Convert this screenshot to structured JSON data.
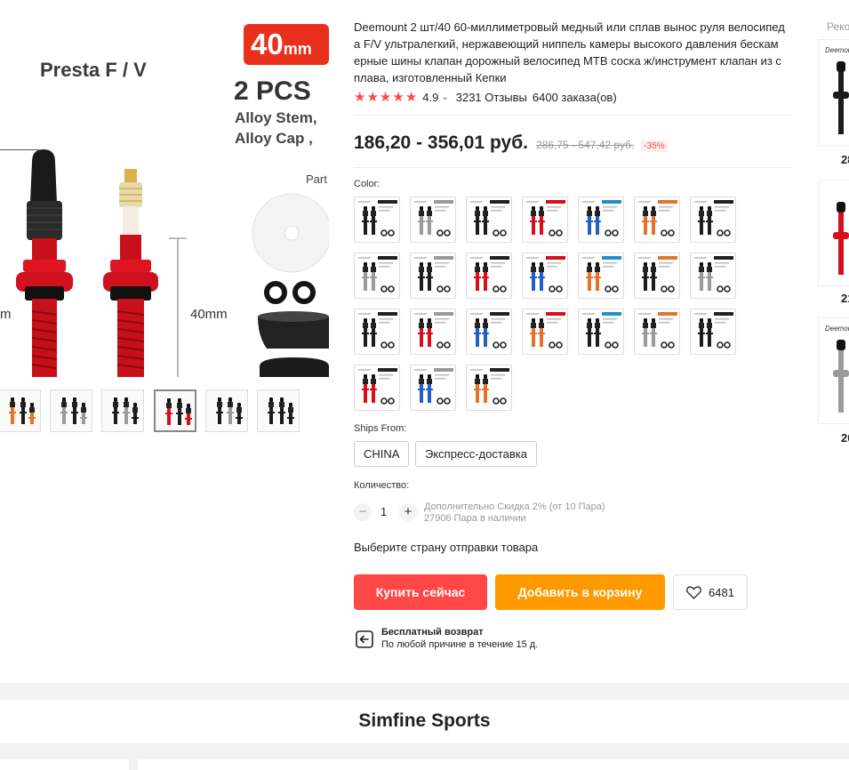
{
  "gallery": {
    "image_label_presta": "Presta F / V",
    "image_badge": "40",
    "image_badge_unit": "mm",
    "image_pcs": "2 PCS",
    "image_alloy_stem": "Alloy Stem,",
    "image_alloy_cap": "Alloy Cap ,",
    "image_parts": "Part",
    "image_measure": "40mm",
    "image_measure_cut": "m",
    "thumbnail_count": 6,
    "active_thumbnail": 4
  },
  "product": {
    "title": "Deemount 2 шт/40 60-миллиметровый медный или сплав вынос руля велосипед a F/V ультралегкий, нержавеющий ниппель камеры высокого давления бескам ерные шины клапан дорожный велосипед MTB соска ж/инструмент клапан из с плава, изготовленный Кепки",
    "rating": "4.9",
    "stars": 5,
    "reviews": "3231 Отзывы",
    "orders": "6400 заказа(ов)",
    "price_current": "186,20 - 356,01 руб.",
    "price_old": "286,75 - 547,42 руб.",
    "discount": "-35%"
  },
  "options": {
    "color_label": "Color:",
    "swatch_count": 24,
    "ships_from_label": "Ships From:",
    "ships_from": [
      "CHINA",
      "Экспресс-доставка"
    ],
    "quantity_label": "Количество:",
    "quantity_minus": "−",
    "quantity_plus": "+",
    "quantity_value": "1",
    "quantity_discount": "Дополнительно Скидка 2% (от 10 Пара)",
    "quantity_stock": "27906 Пара в наличии",
    "ship_country": "Выберите страну отправки товара"
  },
  "actions": {
    "buy_now": "Купить сейчас",
    "add_to_cart": "Добавить в корзину",
    "wishlist_count": "6481"
  },
  "returns": {
    "title": "Бесплатный возврат",
    "desc": "По любой причине в течение 15 д."
  },
  "recommendations": {
    "title": "Реко",
    "brand_label": "Deemount",
    "prices": [
      "28",
      "21",
      "20"
    ]
  },
  "store": {
    "name": "Simfine Sports"
  },
  "colors": {
    "accent_red": "#ff4747",
    "accent_orange": "#ff9900",
    "valve_red": "#d4101c",
    "valve_blue": "#1f5fc8",
    "valve_orange": "#e4732a",
    "valve_black": "#1c1c1c",
    "valve_silver": "#9a9a9a"
  }
}
